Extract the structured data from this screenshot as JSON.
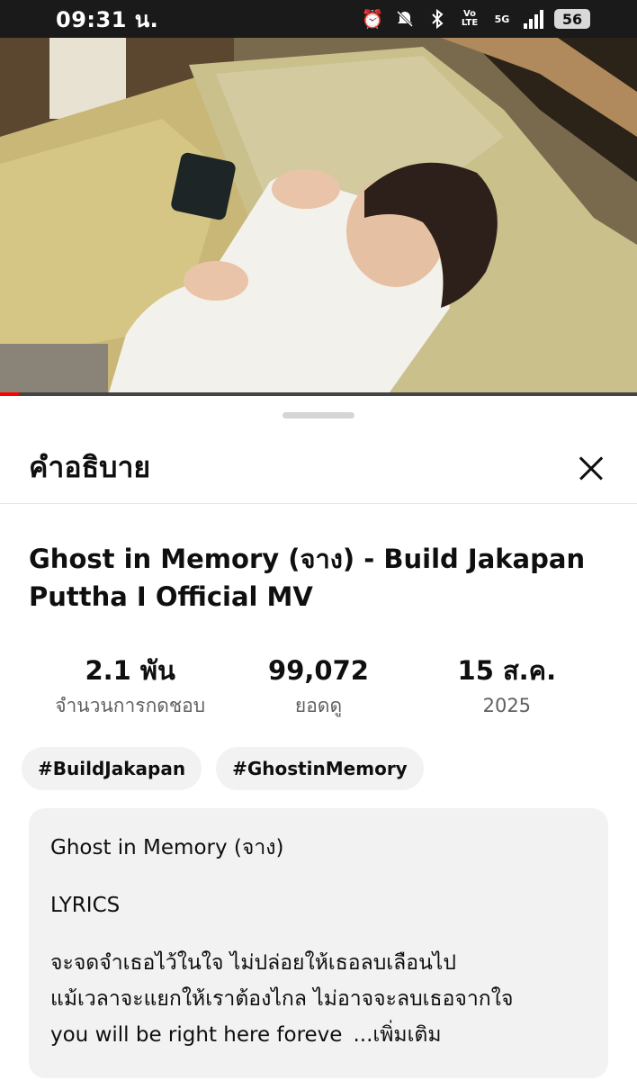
{
  "status_bar": {
    "time": "09:31 น.",
    "network": "5G",
    "volte": "Vo LTE",
    "battery": "56"
  },
  "sheet": {
    "title": "คำอธิบาย"
  },
  "video": {
    "title": "Ghost in Memory (จาง) - Build Jakapan Puttha I Official MV",
    "progress_fraction": 0.03
  },
  "stats": [
    {
      "value": "2.1 พัน",
      "label": "จำนวนการกดชอบ"
    },
    {
      "value": "99,072",
      "label": "ยอดดู"
    },
    {
      "value": "15 ส.ค.",
      "label": "2025"
    }
  ],
  "tags": [
    "#BuildJakapan",
    "#GhostinMemory"
  ],
  "description": {
    "line1": "Ghost in Memory (จาง)",
    "line2": "LYRICS",
    "line3": "จะจดจำเธอไว้ในใจ ไม่ปล่อยให้เธอลบเลือนไป",
    "line4": "แม้เวลาจะแยกให้เราต้องไกล ไม่อาจจะลบเธอจากใจ",
    "line5": "you will be right here foreve",
    "more": "...เพิ่มเติม"
  }
}
